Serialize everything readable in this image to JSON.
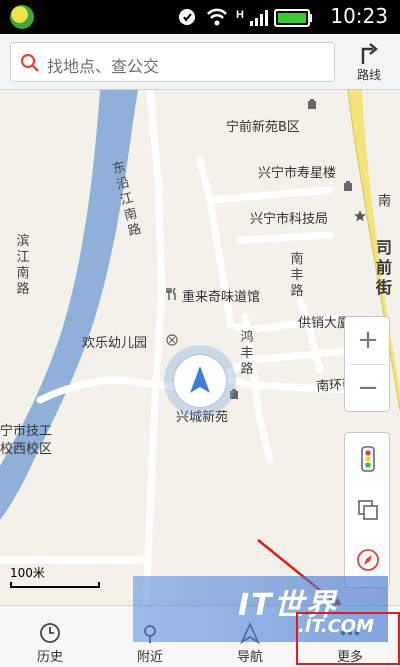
{
  "status_bar": {
    "time": "10:23"
  },
  "search": {
    "placeholder": "找地点、查公交",
    "route_label": "路线"
  },
  "map": {
    "places": {
      "ningqian": "宁前新苑B区",
      "shouxing": "兴宁市寿星楼",
      "keji": "兴宁市科技局",
      "nan": "南",
      "chonglai": "重来奇味道馆",
      "gongxiao": "供销大厦",
      "huanle": "欢乐幼儿园",
      "xingcheng": "兴城新苑",
      "jigong_1": "宁市技工",
      "jigong_2": "校西校区"
    },
    "roads": {
      "dongyanjiang": "东沿江南路",
      "binjiang": "滨江南路",
      "nanfeng": "南丰路",
      "hongfeng": "鸿丰路",
      "nanhuan": "南环西路",
      "siqian": "司前街"
    },
    "scale": "100米"
  },
  "bottom_tabs": [
    {
      "label": "历史",
      "icon": "clock-icon"
    },
    {
      "label": "附近",
      "icon": "nearby-icon"
    },
    {
      "label": "导航",
      "icon": "navigation-icon"
    },
    {
      "label": "更多",
      "icon": "more-icon"
    }
  ],
  "watermark": {
    "line1": "IT世界",
    "line2": ".IT.COM"
  },
  "colors": {
    "river": "#8fb0d8",
    "main_road": "#f4e27a",
    "accent": "#e21b1b",
    "locator": "#3d7cd9"
  }
}
